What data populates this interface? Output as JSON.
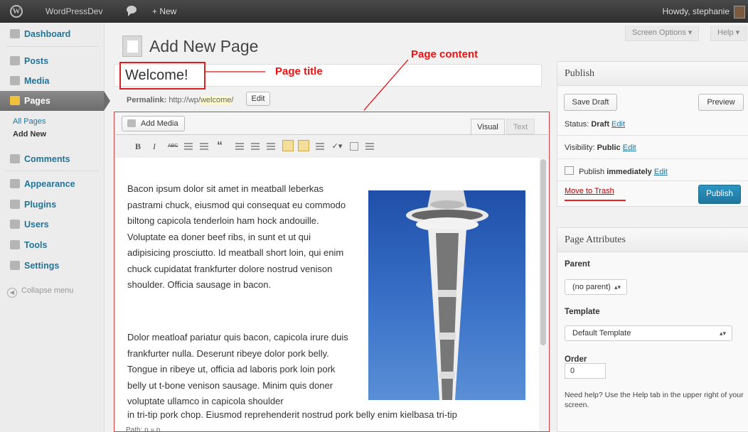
{
  "adminbar": {
    "site_name": "WordPressDev",
    "new_label": "+ New",
    "howdy": "Howdy, stephanie"
  },
  "sidebar": {
    "items": [
      {
        "label": "Dashboard",
        "icon": "dashboard-icon"
      },
      {
        "label": "Posts",
        "icon": "posts-icon"
      },
      {
        "label": "Media",
        "icon": "media-icon"
      },
      {
        "label": "Pages",
        "icon": "pages-icon",
        "current": true
      },
      {
        "label": "Comments",
        "icon": "comments-icon"
      },
      {
        "label": "Appearance",
        "icon": "appearance-icon"
      },
      {
        "label": "Plugins",
        "icon": "plugins-icon"
      },
      {
        "label": "Users",
        "icon": "users-icon"
      },
      {
        "label": "Tools",
        "icon": "tools-icon"
      },
      {
        "label": "Settings",
        "icon": "settings-icon"
      }
    ],
    "submenu": [
      "All Pages",
      "Add New"
    ],
    "collapse": "Collapse menu"
  },
  "screen_options": "Screen Options ▾",
  "help": "Help ▾",
  "page_heading": "Add New Page",
  "title_field": {
    "value": "Welcome!"
  },
  "annotations": {
    "title": "Page title",
    "content": "Page content"
  },
  "permalink": {
    "label": "Permalink:",
    "base": "http://wp/",
    "slug": "welcome",
    "tail": "/",
    "edit": "Edit"
  },
  "editor": {
    "add_media": "Add Media",
    "tab_visual": "Visual",
    "tab_text": "Text",
    "toolbar": [
      "B",
      "I",
      "ABC",
      "“"
    ],
    "paragraph1": "Bacon ipsum dolor sit amet in meatball leberkas pastrami chuck, eiusmod qui consequat eu commodo biltong capicola tenderloin ham hock andouille. Voluptate ea doner beef ribs, in sunt et ut qui adipisicing prosciutto. Id meatball short loin, qui enim chuck cupidatat frankfurter dolore nostrud venison shoulder. Officia sausage in bacon.",
    "paragraph2": "Dolor meatloaf pariatur quis bacon, capicola irure duis frankfurter nulla. Deserunt ribeye dolor pork belly. Tongue in ribeye ut, officia ad laboris pork loin pork belly ut t-bone venison sausage. Minim quis doner voluptate ullamco in capicola shoulder",
    "paragraph3": "in tri-tip pork chop. Eiusmod reprehenderit nostrud pork belly enim kielbasa tri-tip",
    "path": "Path: p » p"
  },
  "publish": {
    "title": "Publish",
    "save_draft": "Save Draft",
    "preview": "Preview",
    "status_label": "Status:",
    "status_value": "Draft",
    "visibility_label": "Visibility:",
    "visibility_value": "Public",
    "publish_label": "Publish",
    "publish_value": "immediately",
    "edit": "Edit",
    "trash": "Move to Trash",
    "publish_button": "Publish"
  },
  "attributes": {
    "title": "Page Attributes",
    "parent_label": "Parent",
    "parent_value": "(no parent)",
    "template_label": "Template",
    "template_value": "Default Template",
    "order_label": "Order",
    "order_value": "0",
    "help": "Need help? Use the Help tab in the upper right of your screen."
  },
  "colors": {
    "accent": "#21759b",
    "annotation": "#e11111",
    "publish_button": "#21759b"
  }
}
